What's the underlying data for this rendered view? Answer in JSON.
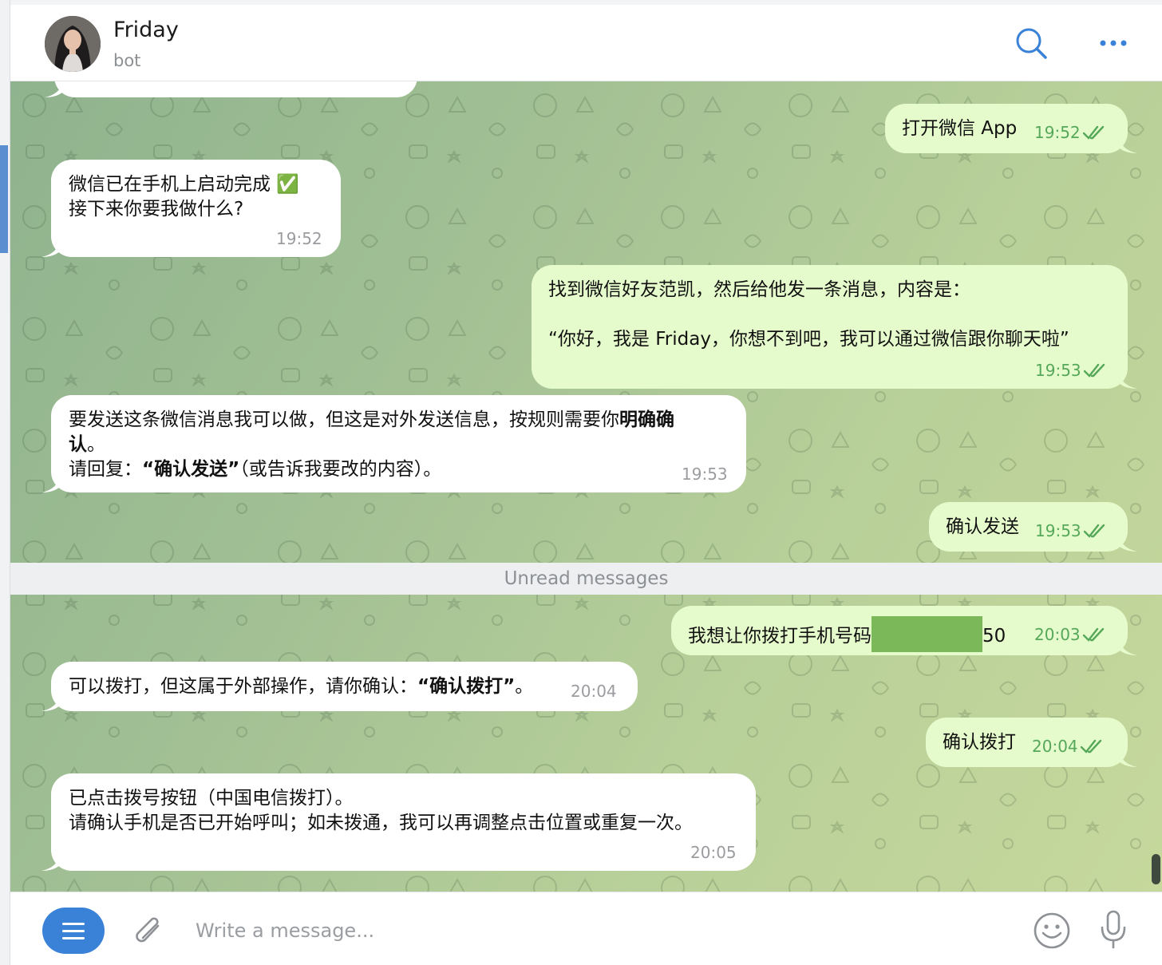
{
  "header": {
    "name": "Friday",
    "status": "bot"
  },
  "messages": [
    {
      "id": "m1",
      "dir": "out",
      "text": "打开微信 App",
      "time": "19:52"
    },
    {
      "id": "m2",
      "dir": "in",
      "text": "微信已在手机上启动完成 ✅\n接下来你要我做什么?",
      "time": "19:52"
    },
    {
      "id": "m3",
      "dir": "out",
      "text": "找到微信好友范凯，然后给他发一条消息，内容是：\n\n“你好，我是 Friday，你想不到吧，我可以通过微信跟你聊天啦”",
      "time": "19:53"
    },
    {
      "id": "m4",
      "dir": "in",
      "line1_plain": "要发送这条微信消息我可以做，但这是对外发送信息，按规则需要你",
      "line1_bold": "明确确",
      "line2_bold": "认",
      "line2_plain": "。",
      "line3_plain_a": "请回复：",
      "line3_bold": "“确认发送”",
      "line3_plain_b": "（或告诉我要改的内容）。",
      "time": "19:53"
    },
    {
      "id": "m5",
      "dir": "out",
      "text": "确认发送",
      "time": "19:53"
    },
    {
      "id": "m6",
      "dir": "out",
      "text_a": "我想让你拨打手机号码",
      "text_b": "50",
      "time": "20:03"
    },
    {
      "id": "m7",
      "dir": "in",
      "text_a": "可以拨打，但这属于外部操作，请你确认：",
      "text_bold": "“确认拨打”",
      "text_b": "。",
      "time": "20:04"
    },
    {
      "id": "m8",
      "dir": "out",
      "text": "确认拨打",
      "time": "20:04"
    },
    {
      "id": "m9",
      "dir": "in",
      "text": "已点击拨号按钮（中国电信拨打）。\n请确认手机是否已开始呼叫；如未拨通，我可以再调整点击位置或重复一次。",
      "time": "20:05"
    }
  ],
  "unread_label": "Unread messages",
  "composer": {
    "placeholder": "Write a message..."
  },
  "colors": {
    "accent": "#3a82d8",
    "outgoing_bubble": "#e6fbcc",
    "incoming_bubble": "#ffffff",
    "read_check": "#55a85a"
  },
  "icons": [
    "search-icon",
    "more-icon",
    "menu-icon",
    "attach-icon",
    "emoji-icon",
    "microphone-icon",
    "double-check-icon"
  ]
}
